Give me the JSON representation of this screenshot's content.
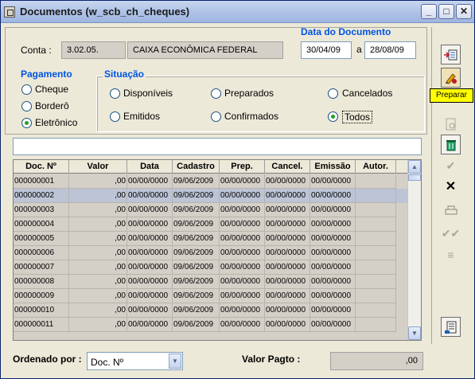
{
  "window": {
    "title": "Documentos (w_scb_ch_cheques)"
  },
  "account": {
    "label": "Conta :",
    "code": "3.02.05.",
    "name": "CAIXA ECONÔMICA FEDERAL"
  },
  "date_filter": {
    "title": "Data do Documento",
    "from": "30/04/09",
    "sep": "a",
    "to": "28/08/09"
  },
  "payment": {
    "title": "Pagamento",
    "options": [
      {
        "label": "Cheque",
        "selected": false
      },
      {
        "label": "Borderô",
        "selected": false
      },
      {
        "label": "Eletrônico",
        "selected": true
      }
    ]
  },
  "situation": {
    "title": "Situação",
    "options": [
      {
        "label": "Disponíveis",
        "selected": false
      },
      {
        "label": "Preparados",
        "selected": false
      },
      {
        "label": "Cancelados",
        "selected": false
      },
      {
        "label": "Emitidos",
        "selected": false
      },
      {
        "label": "Confirmados",
        "selected": false
      },
      {
        "label": "Todos",
        "selected": true
      }
    ]
  },
  "grid": {
    "headers": [
      "Doc. Nº",
      "Valor",
      "Data",
      "Cadastro",
      "Prep.",
      "Cancel.",
      "Emissão",
      "Autor."
    ],
    "rows": [
      [
        "000000001",
        ",00",
        "00/00/0000",
        "09/06/2009",
        "00/00/0000",
        "00/00/0000",
        "00/00/0000",
        ""
      ],
      [
        "000000002",
        ",00",
        "00/00/0000",
        "09/06/2009",
        "00/00/0000",
        "00/00/0000",
        "00/00/0000",
        ""
      ],
      [
        "000000003",
        ",00",
        "00/00/0000",
        "09/06/2009",
        "00/00/0000",
        "00/00/0000",
        "00/00/0000",
        ""
      ],
      [
        "000000004",
        ",00",
        "00/00/0000",
        "09/06/2009",
        "00/00/0000",
        "00/00/0000",
        "00/00/0000",
        ""
      ],
      [
        "000000005",
        ",00",
        "00/00/0000",
        "09/06/2009",
        "00/00/0000",
        "00/00/0000",
        "00/00/0000",
        ""
      ],
      [
        "000000006",
        ",00",
        "00/00/0000",
        "09/06/2009",
        "00/00/0000",
        "00/00/0000",
        "00/00/0000",
        ""
      ],
      [
        "000000007",
        ",00",
        "00/00/0000",
        "09/06/2009",
        "00/00/0000",
        "00/00/0000",
        "00/00/0000",
        ""
      ],
      [
        "000000008",
        ",00",
        "00/00/0000",
        "09/06/2009",
        "00/00/0000",
        "00/00/0000",
        "00/00/0000",
        ""
      ],
      [
        "000000009",
        ",00",
        "00/00/0000",
        "09/06/2009",
        "00/00/0000",
        "00/00/0000",
        "00/00/0000",
        ""
      ],
      [
        "000000010",
        ",00",
        "00/00/0000",
        "09/06/2009",
        "00/00/0000",
        "00/00/0000",
        "00/00/0000",
        ""
      ],
      [
        "000000011",
        ",00",
        "00/00/0000",
        "09/06/2009",
        "00/00/0000",
        "00/00/0000",
        "00/00/0000",
        ""
      ]
    ],
    "selected_row": 1
  },
  "footer": {
    "order_label": "Ordenado por :",
    "order_value": "Doc. Nº",
    "value_label": "Valor Pagto :",
    "value": ",00"
  },
  "tooltip": "Preparar",
  "colors": {
    "accent": "#0054e3",
    "selected_row": "#bcc4d6",
    "tooltip_bg": "#ffff00",
    "radio_check": "#21a121"
  },
  "toolbar_icons": [
    "insert-row-icon",
    "prepare-icon",
    "preview-icon",
    "delete-icon",
    "confirm-icon",
    "cancel-icon",
    "print-icon",
    "double-check-icon",
    "list-icon",
    "report-icon"
  ]
}
